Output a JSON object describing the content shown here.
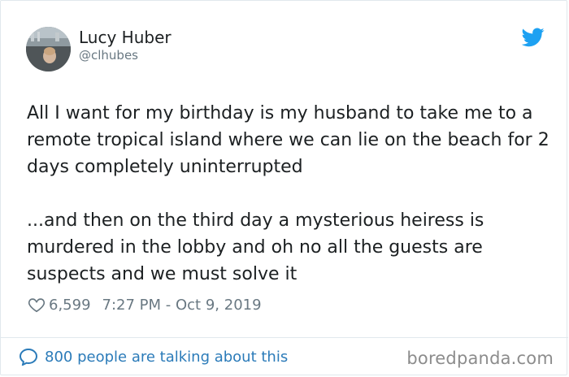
{
  "author": {
    "name": "Lucy Huber",
    "handle": "@clhubes"
  },
  "tweet": {
    "paragraph1": "All I want for my birthday is my husband to take me to a remote tropical island where we can lie on the beach for 2 days completely uninterrupted",
    "paragraph2": "...and then on the third day a mysterious heiress is murdered in the lobby and oh no all the guests are suspects and we must solve it"
  },
  "meta": {
    "likes": "6,599",
    "timestamp": "7:27 PM - Oct 9, 2019"
  },
  "footer": {
    "talking": "800 people are talking about this",
    "watermark": "boredpanda.com"
  },
  "colors": {
    "twitter_blue": "#1da1f2",
    "link_blue": "#2b7bb9",
    "muted": "#697882"
  },
  "icons": [
    "twitter-bird-icon",
    "heart-icon",
    "speech-bubble-icon"
  ]
}
